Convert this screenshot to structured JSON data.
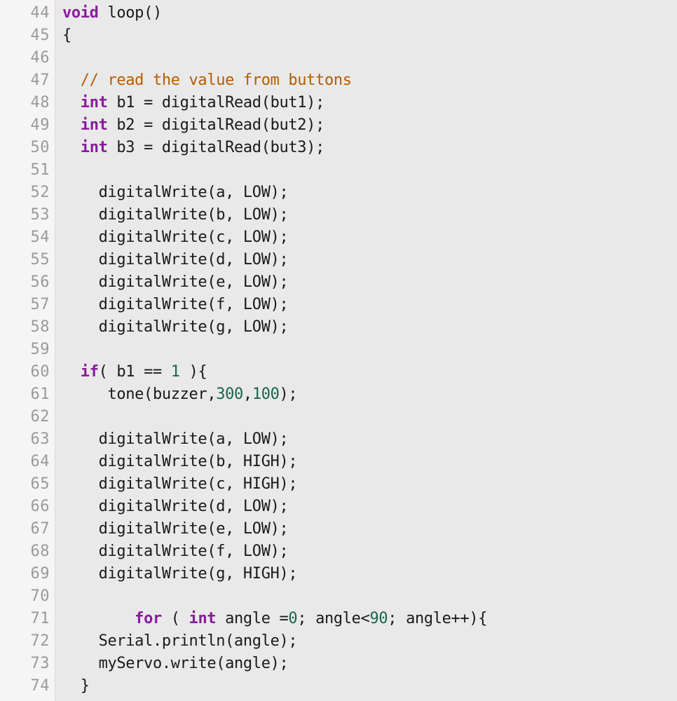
{
  "editor": {
    "language": "arduino-cpp",
    "first_line_number": 44,
    "last_line_number": 74,
    "colors": {
      "gutter_background": "#f5f5f5",
      "gutter_text": "#9a9a9a",
      "gutter_border": "#dcdcdc",
      "code_background": "#e9e9e9",
      "default_text": "#1a1a1a",
      "keyword": "#8a1a9e",
      "comment": "#b35c00",
      "number": "#19654f"
    }
  },
  "lines": [
    {
      "number": "44",
      "tokens": [
        {
          "t": "keyword",
          "s": "void"
        },
        {
          "t": "plain",
          "s": " loop()"
        }
      ]
    },
    {
      "number": "45",
      "tokens": [
        {
          "t": "plain",
          "s": "{"
        }
      ]
    },
    {
      "number": "46",
      "tokens": [
        {
          "t": "plain",
          "s": ""
        }
      ]
    },
    {
      "number": "47",
      "tokens": [
        {
          "t": "comment",
          "s": "  // read the value from buttons"
        }
      ]
    },
    {
      "number": "48",
      "tokens": [
        {
          "t": "plain",
          "s": "  "
        },
        {
          "t": "keyword",
          "s": "int"
        },
        {
          "t": "plain",
          "s": " b1 = digitalRead(but1);"
        }
      ]
    },
    {
      "number": "49",
      "tokens": [
        {
          "t": "plain",
          "s": "  "
        },
        {
          "t": "keyword",
          "s": "int"
        },
        {
          "t": "plain",
          "s": " b2 = digitalRead(but2);"
        }
      ]
    },
    {
      "number": "50",
      "tokens": [
        {
          "t": "plain",
          "s": "  "
        },
        {
          "t": "keyword",
          "s": "int"
        },
        {
          "t": "plain",
          "s": " b3 = digitalRead(but3);"
        }
      ]
    },
    {
      "number": "51",
      "tokens": [
        {
          "t": "plain",
          "s": ""
        }
      ]
    },
    {
      "number": "52",
      "tokens": [
        {
          "t": "plain",
          "s": "    digitalWrite(a, LOW);"
        }
      ]
    },
    {
      "number": "53",
      "tokens": [
        {
          "t": "plain",
          "s": "    digitalWrite(b, LOW);"
        }
      ]
    },
    {
      "number": "54",
      "tokens": [
        {
          "t": "plain",
          "s": "    digitalWrite(c, LOW);"
        }
      ]
    },
    {
      "number": "55",
      "tokens": [
        {
          "t": "plain",
          "s": "    digitalWrite(d, LOW);"
        }
      ]
    },
    {
      "number": "56",
      "tokens": [
        {
          "t": "plain",
          "s": "    digitalWrite(e, LOW);"
        }
      ]
    },
    {
      "number": "57",
      "tokens": [
        {
          "t": "plain",
          "s": "    digitalWrite(f, LOW);"
        }
      ]
    },
    {
      "number": "58",
      "tokens": [
        {
          "t": "plain",
          "s": "    digitalWrite(g, LOW);"
        }
      ]
    },
    {
      "number": "59",
      "tokens": [
        {
          "t": "plain",
          "s": ""
        }
      ]
    },
    {
      "number": "60",
      "tokens": [
        {
          "t": "plain",
          "s": "  "
        },
        {
          "t": "keyword",
          "s": "if"
        },
        {
          "t": "plain",
          "s": "( b1 == "
        },
        {
          "t": "number",
          "s": "1"
        },
        {
          "t": "plain",
          "s": " ){"
        }
      ]
    },
    {
      "number": "61",
      "tokens": [
        {
          "t": "plain",
          "s": "     tone(buzzer,"
        },
        {
          "t": "number",
          "s": "300"
        },
        {
          "t": "plain",
          "s": ","
        },
        {
          "t": "number",
          "s": "100"
        },
        {
          "t": "plain",
          "s": ");"
        }
      ]
    },
    {
      "number": "62",
      "tokens": [
        {
          "t": "plain",
          "s": ""
        }
      ]
    },
    {
      "number": "63",
      "tokens": [
        {
          "t": "plain",
          "s": "    digitalWrite(a, LOW);"
        }
      ]
    },
    {
      "number": "64",
      "tokens": [
        {
          "t": "plain",
          "s": "    digitalWrite(b, HIGH);"
        }
      ]
    },
    {
      "number": "65",
      "tokens": [
        {
          "t": "plain",
          "s": "    digitalWrite(c, HIGH);"
        }
      ]
    },
    {
      "number": "66",
      "tokens": [
        {
          "t": "plain",
          "s": "    digitalWrite(d, LOW);"
        }
      ]
    },
    {
      "number": "67",
      "tokens": [
        {
          "t": "plain",
          "s": "    digitalWrite(e, LOW);"
        }
      ]
    },
    {
      "number": "68",
      "tokens": [
        {
          "t": "plain",
          "s": "    digitalWrite(f, LOW);"
        }
      ]
    },
    {
      "number": "69",
      "tokens": [
        {
          "t": "plain",
          "s": "    digitalWrite(g, HIGH);"
        }
      ]
    },
    {
      "number": "70",
      "tokens": [
        {
          "t": "plain",
          "s": ""
        }
      ]
    },
    {
      "number": "71",
      "tokens": [
        {
          "t": "plain",
          "s": "        "
        },
        {
          "t": "keyword",
          "s": "for"
        },
        {
          "t": "plain",
          "s": " ( "
        },
        {
          "t": "keyword",
          "s": "int"
        },
        {
          "t": "plain",
          "s": " angle ="
        },
        {
          "t": "number",
          "s": "0"
        },
        {
          "t": "plain",
          "s": "; angle<"
        },
        {
          "t": "number",
          "s": "90"
        },
        {
          "t": "plain",
          "s": "; angle++){"
        }
      ]
    },
    {
      "number": "72",
      "tokens": [
        {
          "t": "plain",
          "s": "    Serial.println(angle);"
        }
      ]
    },
    {
      "number": "73",
      "tokens": [
        {
          "t": "plain",
          "s": "    myServo.write(angle);"
        }
      ]
    },
    {
      "number": "74",
      "tokens": [
        {
          "t": "plain",
          "s": "  }"
        }
      ]
    }
  ]
}
